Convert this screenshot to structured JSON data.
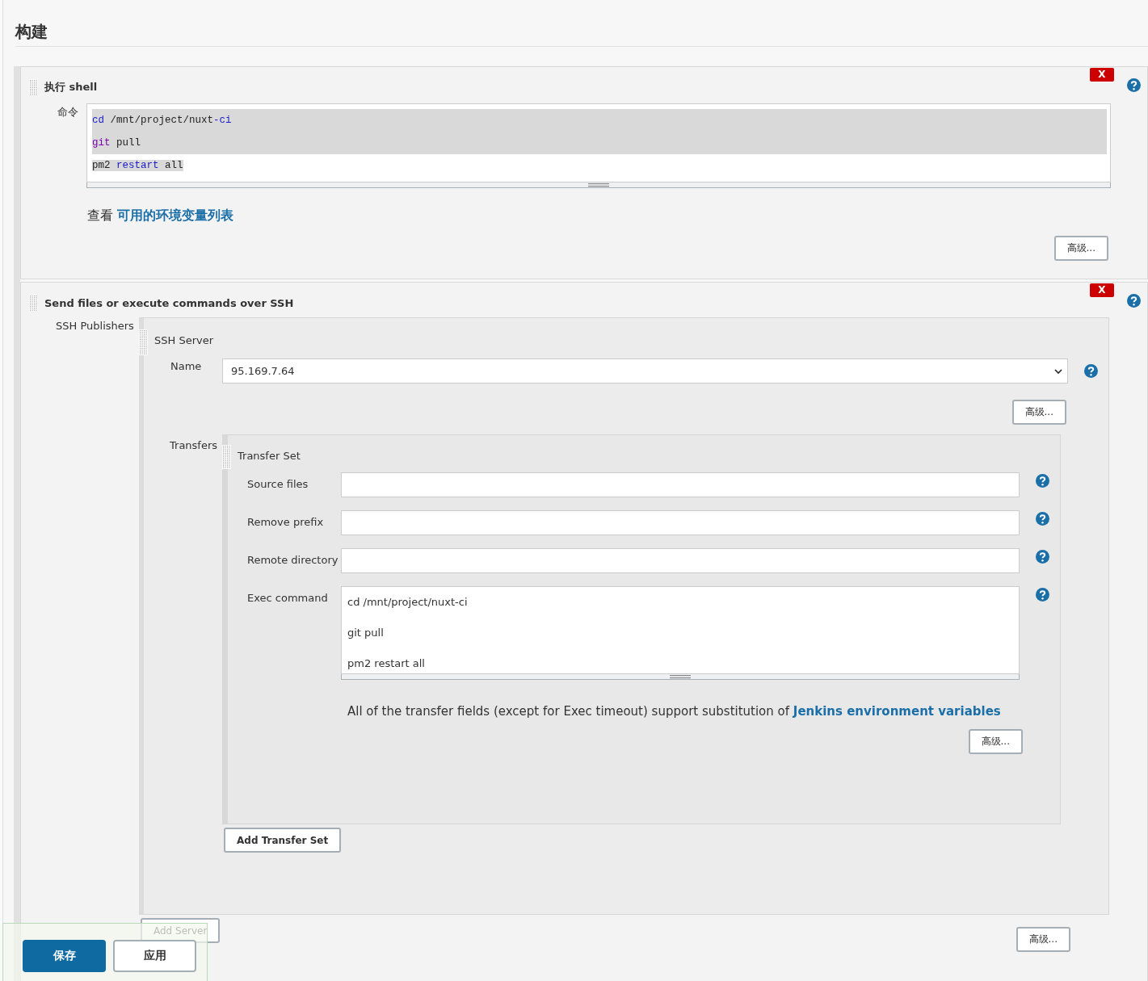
{
  "section_title": "构建",
  "steps": [
    {
      "kind": "shell",
      "title": "执行 shell",
      "delete_label": "X",
      "command_label": "命令",
      "command_lines": [
        {
          "selected": true,
          "tokens": [
            {
              "text": "cd",
              "kind": "keyword"
            },
            {
              "text": " /mnt/project/nuxt",
              "kind": "plain"
            },
            {
              "text": "-ci",
              "kind": "keyword"
            }
          ]
        },
        {
          "selected": true,
          "tokens": [
            {
              "text": "git",
              "kind": "builtin"
            },
            {
              "text": " pull",
              "kind": "plain"
            }
          ]
        },
        {
          "selected": true,
          "tokens": [
            {
              "text": "pm2 ",
              "kind": "plain"
            },
            {
              "text": "restart",
              "kind": "keyword"
            },
            {
              "text": " all",
              "kind": "plain"
            }
          ]
        }
      ],
      "help_prefix": "查看",
      "help_link": "可用的环境变量列表",
      "advanced_button": "高级..."
    },
    {
      "kind": "ssh",
      "title": "Send files or execute commands over SSH",
      "delete_label": "X",
      "publishers_label": "SSH Publishers",
      "server": {
        "title": "SSH Server",
        "name_label": "Name",
        "name_value": "95.169.7.64",
        "advanced_button": "高级...",
        "transfers_label": "Transfers",
        "transfer_set": {
          "title": "Transfer Set",
          "fields": [
            {
              "label": "Source files",
              "kind": "input"
            },
            {
              "label": "Remove prefix",
              "kind": "input"
            },
            {
              "label": "Remote directory",
              "kind": "input"
            },
            {
              "label": "Exec command",
              "kind": "textarea",
              "lines": [
                "cd /mnt/project/nuxt-ci",
                "git pull",
                "pm2 restart all"
              ]
            }
          ],
          "note": "All of the transfer fields (except for Exec timeout) support substitution of",
          "note_link": "Jenkins environment variables",
          "advanced_button": "高级..."
        },
        "add_transfer_button": "Add Transfer Set"
      },
      "add_server_button": "Add Server",
      "advanced_button": "高级..."
    }
  ],
  "footer": {
    "buttons": [
      {
        "label": "保存",
        "kind": "primary"
      },
      {
        "label": "应用",
        "kind": "secondary"
      }
    ]
  }
}
